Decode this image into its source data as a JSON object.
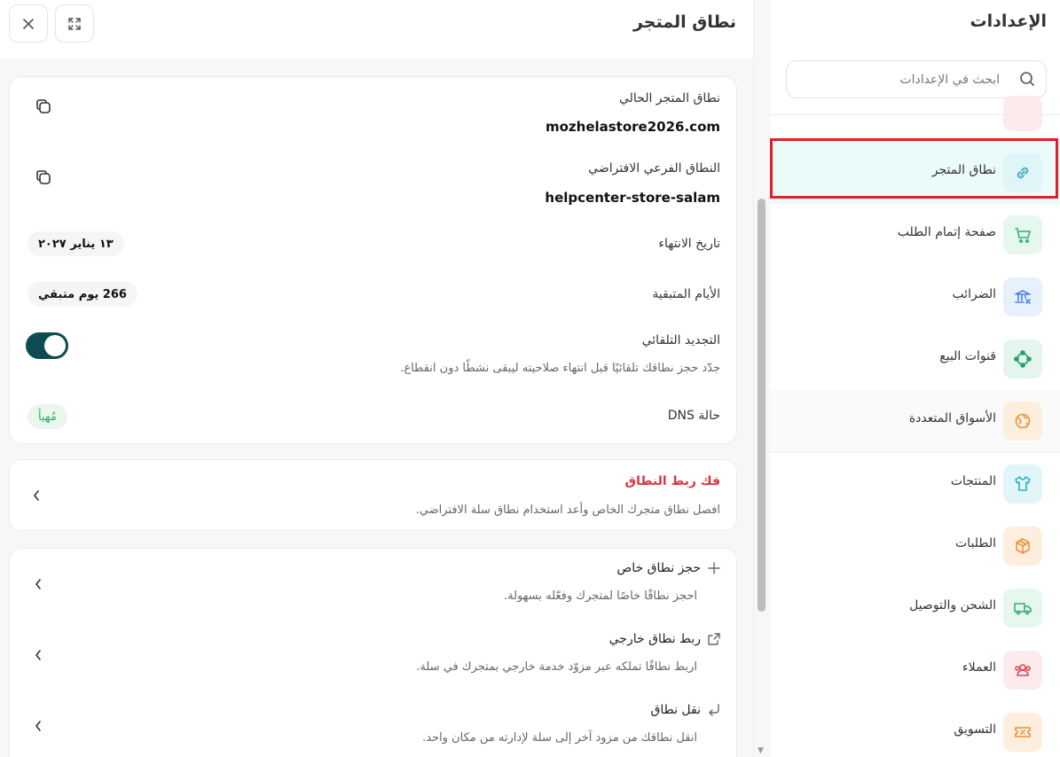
{
  "main": {
    "title": "نطاق المتجر",
    "current_domain": {
      "label": "نطاق المتجر الحالي",
      "value": "mozhelastore2026.com"
    },
    "default_subdomain": {
      "label": "النطاق الفرعي الافتراضي",
      "value": "helpcenter-store-salam"
    },
    "expiry": {
      "label": "تاريخ الانتهاء",
      "value": "١٣ يناير ٢٠٢٧"
    },
    "days_remaining": {
      "label": "الأيام المتبقية",
      "value": "266 يوم متبقي"
    },
    "auto_renew": {
      "label": "التجديد التلقائي",
      "description": "جدّد حجز نطاقك تلقائيًا قبل انتهاء صلاحيته ليبقى نشطًا دون انقطاع.",
      "enabled": true
    },
    "dns": {
      "label": "حالة DNS",
      "value": "مُهيأ"
    },
    "unlink": {
      "title": "فك ربط النطاق",
      "description": "افصل نطاق متجرك الخاص وأعد استخدام نطاق سلة الافتراضي."
    },
    "options": [
      {
        "title": "حجز نطاق خاص",
        "description": "احجز نطاقًا خاصًا لمتجرك وفعّله بسهولة.",
        "icon": "plus-icon"
      },
      {
        "title": "ربط نطاق خارجي",
        "description": "اربط نطاقًا تملكه عبر مزوّد خدمة خارجي بمتجرك في سلة.",
        "icon": "external-link-icon"
      },
      {
        "title": "نقل نطاق",
        "description": "انقل نطاقك من مزود آخر إلى سلة لإدارته من مكان واحد.",
        "icon": "return-arrow-icon"
      }
    ]
  },
  "sidebar": {
    "title": "الإعدادات",
    "search_placeholder": "ابحث في الإعدادات",
    "items": [
      {
        "label": "نطاق المتجر",
        "icon": "link-icon",
        "active": true,
        "color": "#3aa6b9"
      },
      {
        "label": "صفحة إتمام الطلب",
        "icon": "cart-icon",
        "color": "#2fb07a"
      },
      {
        "label": "الضرائب",
        "icon": "bank-icon",
        "color": "#4a86e8"
      },
      {
        "label": "قنوات البيع",
        "icon": "channels-icon",
        "color": "#23a06b"
      },
      {
        "label": "الأسواق المتعددة",
        "icon": "globe-icon",
        "color": "#f0913a"
      },
      {
        "label": "المنتجات",
        "icon": "shirt-icon",
        "color": "#27b3c7"
      },
      {
        "label": "الطلبات",
        "icon": "box-icon",
        "color": "#f0913a"
      },
      {
        "label": "الشحن والتوصيل",
        "icon": "truck-icon",
        "color": "#2fb07a"
      },
      {
        "label": "العملاء",
        "icon": "users-icon",
        "color": "#e0485a"
      },
      {
        "label": "التسويق",
        "icon": "ticket-icon",
        "color": "#f0913a"
      }
    ]
  }
}
